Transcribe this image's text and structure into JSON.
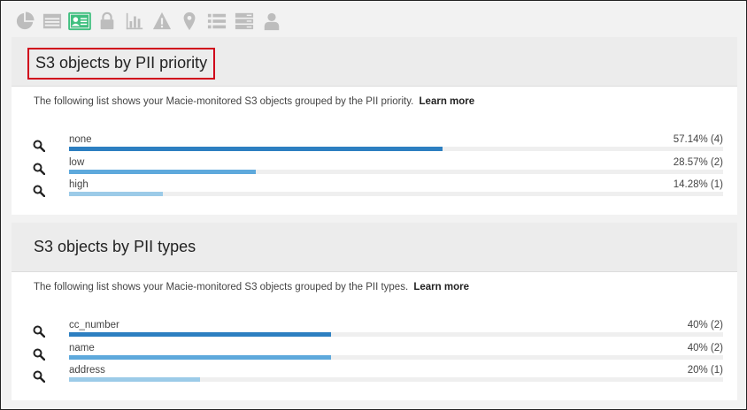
{
  "toolbar": {
    "icons": [
      "pie-chart-icon",
      "list-view-icon",
      "id-card-icon",
      "lock-icon",
      "bar-chart-icon",
      "warning-icon",
      "map-pin-icon",
      "bullet-list-icon",
      "server-icon",
      "user-icon"
    ],
    "active_icon": "id-card-icon",
    "active_color": "#3fbf7f",
    "inactive_color": "#bdbdbd"
  },
  "priority_panel": {
    "title": "S3 objects by PII priority",
    "description": "The following list shows your Macie-monitored S3 objects grouped by the PII priority.",
    "learn_more": "Learn more",
    "rows": [
      {
        "label": "none",
        "value_text": "57.14% (4)",
        "percent": 57.14,
        "color": "#2d7fc1"
      },
      {
        "label": "low",
        "value_text": "28.57% (2)",
        "percent": 28.57,
        "color": "#5ea9dc"
      },
      {
        "label": "high",
        "value_text": "14.28% (1)",
        "percent": 14.28,
        "color": "#9ccbe8"
      }
    ]
  },
  "types_panel": {
    "title": "S3 objects by PII types",
    "description": "The following list shows your Macie-monitored S3 objects grouped by the PII types.",
    "learn_more": "Learn more",
    "rows": [
      {
        "label": "cc_number",
        "value_text": "40% (2)",
        "percent": 40,
        "color": "#2d7fc1"
      },
      {
        "label": "name",
        "value_text": "40% (2)",
        "percent": 40,
        "color": "#5ea9dc"
      },
      {
        "label": "address",
        "value_text": "20% (1)",
        "percent": 20,
        "color": "#9ccbe8"
      }
    ]
  }
}
